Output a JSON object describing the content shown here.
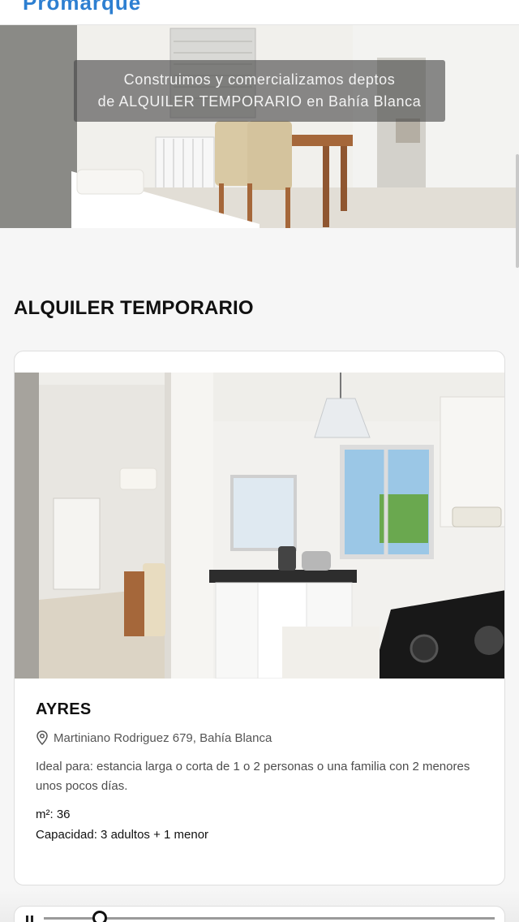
{
  "header": {
    "brand_fragment": "Promarque"
  },
  "hero": {
    "caption_line1": "Construimos y comercializamos deptos",
    "caption_line2": "de ALQUILER TEMPORARIO en Bahía Blanca"
  },
  "section": {
    "title": "ALQUILER TEMPORARIO"
  },
  "listing": {
    "name": "AYRES",
    "address": "Martiniano Rodriguez 679, Bahía Blanca",
    "description": "Ideal para: estancia larga o corta de 1 o 2 personas o una familia con 2 menores unos pocos días.",
    "m2_label": "m²: 36",
    "capacity_label": "Capacidad: 3 adultos + 1 menor"
  },
  "colors": {
    "accent": "#2d7fd1",
    "background": "#f6f6f6",
    "card": "#ffffff"
  },
  "icons": {
    "address": "map-pin-icon"
  }
}
